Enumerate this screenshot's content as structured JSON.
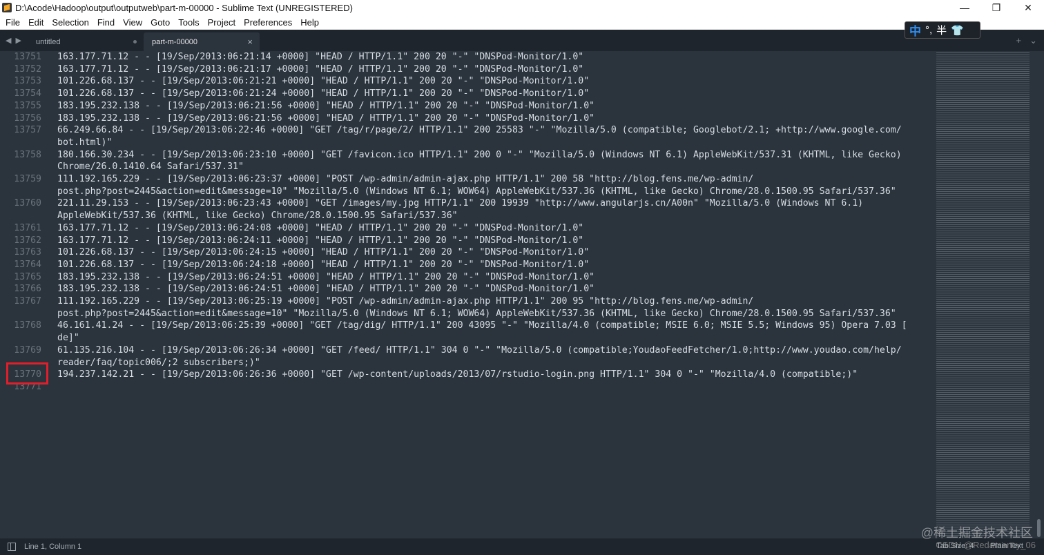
{
  "window": {
    "title": "D:\\Acode\\Hadoop\\output\\outputweb\\part-m-00000 - Sublime Text (UNREGISTERED)",
    "minimize_glyph": "—",
    "maximize_glyph": "❐",
    "close_glyph": "✕"
  },
  "menu": [
    "File",
    "Edit",
    "Selection",
    "Find",
    "View",
    "Goto",
    "Tools",
    "Project",
    "Preferences",
    "Help"
  ],
  "tabs": {
    "untitled": "untitled",
    "active": "part-m-00000",
    "close_glyph": "×",
    "plus_glyph": "+",
    "chevron_glyph": "⌄",
    "left_arrow": "◀",
    "right_arrow": "▶"
  },
  "ime": {
    "mode": "中",
    "punct": "°,",
    "width": "半",
    "skin": "👕"
  },
  "lines": [
    {
      "num": "13751",
      "text": "163.177.71.12 - - [19/Sep/2013:06:21:14 +0000] \"HEAD / HTTP/1.1\" 200 20 \"-\" \"DNSPod-Monitor/1.0\""
    },
    {
      "num": "13752",
      "text": "163.177.71.12 - - [19/Sep/2013:06:21:17 +0000] \"HEAD / HTTP/1.1\" 200 20 \"-\" \"DNSPod-Monitor/1.0\""
    },
    {
      "num": "13753",
      "text": "101.226.68.137 - - [19/Sep/2013:06:21:21 +0000] \"HEAD / HTTP/1.1\" 200 20 \"-\" \"DNSPod-Monitor/1.0\""
    },
    {
      "num": "13754",
      "text": "101.226.68.137 - - [19/Sep/2013:06:21:24 +0000] \"HEAD / HTTP/1.1\" 200 20 \"-\" \"DNSPod-Monitor/1.0\""
    },
    {
      "num": "13755",
      "text": "183.195.232.138 - - [19/Sep/2013:06:21:56 +0000] \"HEAD / HTTP/1.1\" 200 20 \"-\" \"DNSPod-Monitor/1.0\""
    },
    {
      "num": "13756",
      "text": "183.195.232.138 - - [19/Sep/2013:06:21:56 +0000] \"HEAD / HTTP/1.1\" 200 20 \"-\" \"DNSPod-Monitor/1.0\""
    },
    {
      "num": "13757",
      "text": "66.249.66.84 - - [19/Sep/2013:06:22:46 +0000] \"GET /tag/r/page/2/ HTTP/1.1\" 200 25583 \"-\" \"Mozilla/5.0 (compatible; Googlebot/2.1; +http://www.google.com/"
    },
    {
      "num": "",
      "text": "bot.html)\""
    },
    {
      "num": "13758",
      "text": "180.166.30.234 - - [19/Sep/2013:06:23:10 +0000] \"GET /favicon.ico HTTP/1.1\" 200 0 \"-\" \"Mozilla/5.0 (Windows NT 6.1) AppleWebKit/537.31 (KHTML, like Gecko)"
    },
    {
      "num": "",
      "text": "Chrome/26.0.1410.64 Safari/537.31\""
    },
    {
      "num": "13759",
      "text": "111.192.165.229 - - [19/Sep/2013:06:23:37 +0000] \"POST /wp-admin/admin-ajax.php HTTP/1.1\" 200 58 \"http://blog.fens.me/wp-admin/"
    },
    {
      "num": "",
      "text": "post.php?post=2445&action=edit&message=10\" \"Mozilla/5.0 (Windows NT 6.1; WOW64) AppleWebKit/537.36 (KHTML, like Gecko) Chrome/28.0.1500.95 Safari/537.36\""
    },
    {
      "num": "13760",
      "text": "221.11.29.153 - - [19/Sep/2013:06:23:43 +0000] \"GET /images/my.jpg HTTP/1.1\" 200 19939 \"http://www.angularjs.cn/A00n\" \"Mozilla/5.0 (Windows NT 6.1)"
    },
    {
      "num": "",
      "text": "AppleWebKit/537.36 (KHTML, like Gecko) Chrome/28.0.1500.95 Safari/537.36\""
    },
    {
      "num": "13761",
      "text": "163.177.71.12 - - [19/Sep/2013:06:24:08 +0000] \"HEAD / HTTP/1.1\" 200 20 \"-\" \"DNSPod-Monitor/1.0\""
    },
    {
      "num": "13762",
      "text": "163.177.71.12 - - [19/Sep/2013:06:24:11 +0000] \"HEAD / HTTP/1.1\" 200 20 \"-\" \"DNSPod-Monitor/1.0\""
    },
    {
      "num": "13763",
      "text": "101.226.68.137 - - [19/Sep/2013:06:24:15 +0000] \"HEAD / HTTP/1.1\" 200 20 \"-\" \"DNSPod-Monitor/1.0\""
    },
    {
      "num": "13764",
      "text": "101.226.68.137 - - [19/Sep/2013:06:24:18 +0000] \"HEAD / HTTP/1.1\" 200 20 \"-\" \"DNSPod-Monitor/1.0\""
    },
    {
      "num": "13765",
      "text": "183.195.232.138 - - [19/Sep/2013:06:24:51 +0000] \"HEAD / HTTP/1.1\" 200 20 \"-\" \"DNSPod-Monitor/1.0\""
    },
    {
      "num": "13766",
      "text": "183.195.232.138 - - [19/Sep/2013:06:24:51 +0000] \"HEAD / HTTP/1.1\" 200 20 \"-\" \"DNSPod-Monitor/1.0\""
    },
    {
      "num": "13767",
      "text": "111.192.165.229 - - [19/Sep/2013:06:25:19 +0000] \"POST /wp-admin/admin-ajax.php HTTP/1.1\" 200 95 \"http://blog.fens.me/wp-admin/"
    },
    {
      "num": "",
      "text": "post.php?post=2445&action=edit&message=10\" \"Mozilla/5.0 (Windows NT 6.1; WOW64) AppleWebKit/537.36 (KHTML, like Gecko) Chrome/28.0.1500.95 Safari/537.36\""
    },
    {
      "num": "13768",
      "text": "46.161.41.24 - - [19/Sep/2013:06:25:39 +0000] \"GET /tag/dig/ HTTP/1.1\" 200 43095 \"-\" \"Mozilla/4.0 (compatible; MSIE 6.0; MSIE 5.5; Windows 95) Opera 7.03 ["
    },
    {
      "num": "",
      "text": "de]\""
    },
    {
      "num": "13769",
      "text": "61.135.216.104 - - [19/Sep/2013:06:26:34 +0000] \"GET /feed/ HTTP/1.1\" 304 0 \"-\" \"Mozilla/5.0 (compatible;YoudaoFeedFetcher/1.0;http://www.youdao.com/help/"
    },
    {
      "num": "",
      "text": "reader/faq/topic006/;2 subscribers;)\""
    },
    {
      "num": "13770",
      "text": "194.237.142.21 - - [19/Sep/2013:06:26:36 +0000] \"GET /wp-content/uploads/2013/07/rstudio-login.png HTTP/1.1\" 304 0 \"-\" \"Mozilla/4.0 (compatible;)\""
    },
    {
      "num": "13771",
      "text": ""
    }
  ],
  "status": {
    "position": "Line 1, Column 1",
    "tab_size": "Tab Size: 4",
    "syntax": "Plain Text"
  },
  "watermark": {
    "line1": "@稀土掘金技术社区",
    "line2": "CSDN @Redamancy_06"
  },
  "colors": {
    "editor_bg": "#2b333d",
    "text": "#d8dee4",
    "gutter": "#6b737c",
    "highlight": "#e11f2a"
  }
}
